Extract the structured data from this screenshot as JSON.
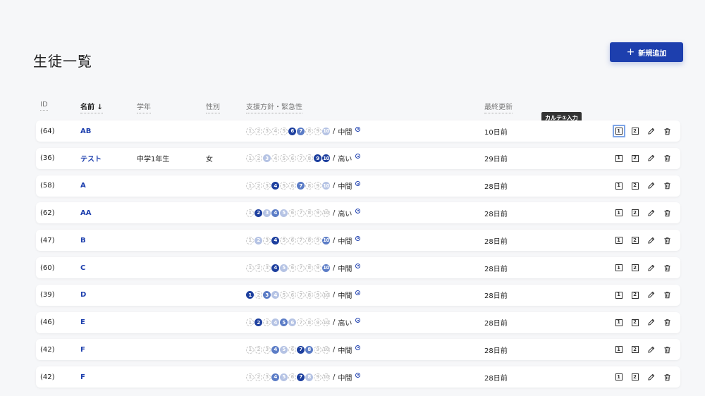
{
  "page": {
    "title": "生徒一覧"
  },
  "toolbar": {
    "add_label": "新規追加",
    "add_icon": "plus-icon"
  },
  "columns": {
    "id": "ID",
    "name": "名前 ↓",
    "grade": "学年",
    "gender": "性別",
    "policy": "支援方針・緊急性",
    "updated": "最終更新"
  },
  "tooltip": "カルテ①入力",
  "colors": {
    "accent": "#1d3fae",
    "level1": "#b5c3e4",
    "level2": "#5b7cc6",
    "level3": "#1d3f9e",
    "inactive": "#c8c8c8"
  },
  "rows": [
    {
      "id": "(64)",
      "name": "AB",
      "grade": "",
      "gender": "",
      "levels": [
        0,
        0,
        0,
        0,
        0,
        3,
        2,
        0,
        0,
        1
      ],
      "urgency": "中間",
      "updated": "10日前",
      "focus_first": true
    },
    {
      "id": "(36)",
      "name": "テスト",
      "grade": "中学1年生",
      "gender": "女",
      "levels": [
        0,
        0,
        1,
        0,
        0,
        0,
        0,
        0,
        3,
        3
      ],
      "urgency": "高い",
      "updated": "29日前"
    },
    {
      "id": "(58)",
      "name": "A",
      "grade": "",
      "gender": "",
      "levels": [
        0,
        0,
        0,
        3,
        0,
        0,
        2,
        0,
        0,
        1
      ],
      "urgency": "中間",
      "updated": "28日前"
    },
    {
      "id": "(62)",
      "name": "AA",
      "grade": "",
      "gender": "",
      "levels": [
        0,
        3,
        1,
        2,
        1,
        0,
        0,
        0,
        0,
        0
      ],
      "urgency": "高い",
      "updated": "28日前"
    },
    {
      "id": "(47)",
      "name": "B",
      "grade": "",
      "gender": "",
      "levels": [
        0,
        1,
        0,
        3,
        0,
        0,
        0,
        0,
        0,
        2
      ],
      "urgency": "中間",
      "updated": "28日前"
    },
    {
      "id": "(60)",
      "name": "C",
      "grade": "",
      "gender": "",
      "levels": [
        0,
        0,
        0,
        3,
        1,
        0,
        0,
        0,
        0,
        2
      ],
      "urgency": "中間",
      "updated": "28日前"
    },
    {
      "id": "(39)",
      "name": "D",
      "grade": "",
      "gender": "",
      "levels": [
        3,
        0,
        2,
        1,
        0,
        0,
        0,
        0,
        0,
        0
      ],
      "urgency": "中間",
      "updated": "28日前"
    },
    {
      "id": "(46)",
      "name": "E",
      "grade": "",
      "gender": "",
      "levels": [
        0,
        3,
        0,
        1,
        2,
        1,
        0,
        0,
        0,
        0
      ],
      "urgency": "高い",
      "updated": "28日前"
    },
    {
      "id": "(42)",
      "name": "F",
      "grade": "",
      "gender": "",
      "levels": [
        0,
        0,
        0,
        2,
        1,
        0,
        3,
        2,
        0,
        0
      ],
      "urgency": "中間",
      "updated": "28日前"
    },
    {
      "id": "(42)",
      "name": "F",
      "grade": "",
      "gender": "",
      "levels": [
        0,
        0,
        0,
        2,
        1,
        0,
        3,
        1,
        0,
        0
      ],
      "urgency": "中間",
      "updated": "28日前"
    }
  ],
  "action_icons": [
    "karte-1-icon",
    "karte-2-icon",
    "pencil-icon",
    "trash-icon"
  ],
  "karte_labels": [
    "1",
    "2"
  ]
}
